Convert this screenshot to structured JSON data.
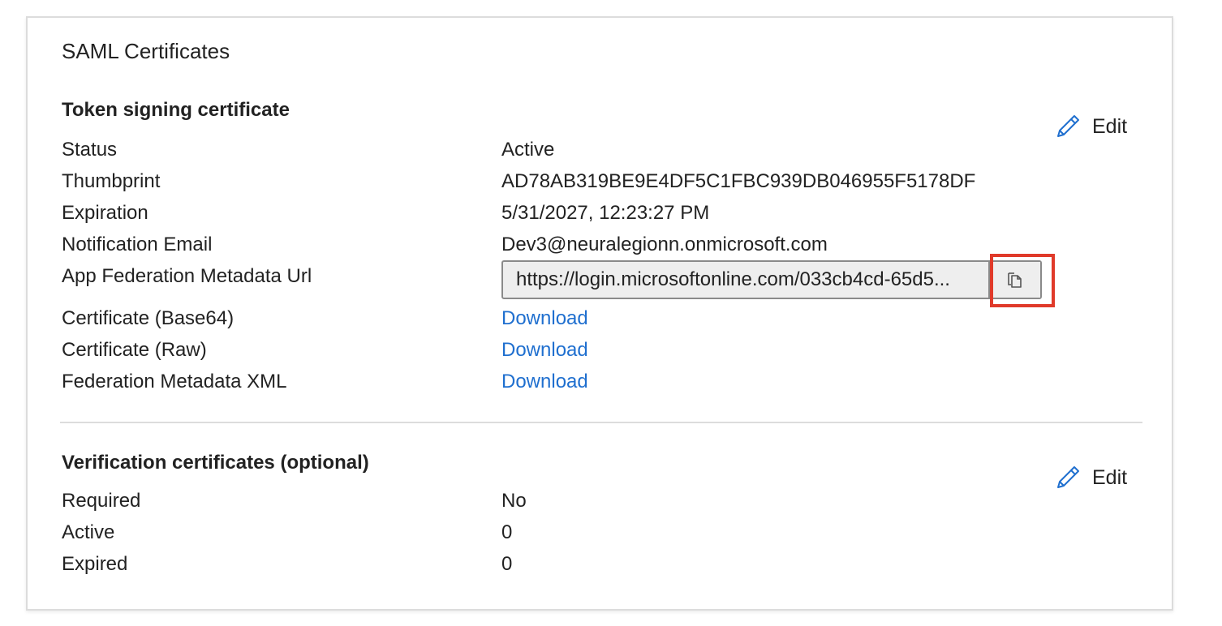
{
  "card": {
    "title": "SAML Certificates"
  },
  "token_signing": {
    "title": "Token signing certificate",
    "edit_label": "Edit",
    "rows": [
      {
        "label": "Status",
        "value": "Active"
      },
      {
        "label": "Thumbprint",
        "value": "AD78AB319BE9E4DF5C1FBC939DB046955F5178DF"
      },
      {
        "label": "Expiration",
        "value": "5/31/2027, 12:23:27 PM"
      },
      {
        "label": "Notification Email",
        "value": "Dev3@neuralegionn.onmicrosoft.com"
      },
      {
        "label": "App Federation Metadata Url",
        "value": "https://login.microsoftonline.com/033cb4cd-65d5..."
      },
      {
        "label": "Certificate (Base64)",
        "value": "Download"
      },
      {
        "label": "Certificate (Raw)",
        "value": "Download"
      },
      {
        "label": "Federation Metadata XML",
        "value": "Download"
      }
    ]
  },
  "verification": {
    "title": "Verification certificates (optional)",
    "edit_label": "Edit",
    "rows": [
      {
        "label": "Required",
        "value": "No"
      },
      {
        "label": "Active",
        "value": "0"
      },
      {
        "label": "Expired",
        "value": "0"
      }
    ]
  },
  "icons": {
    "edit": "pencil-icon",
    "copy": "copy-icon"
  },
  "colors": {
    "link": "#1f6fcf",
    "highlight": "#e03a2a",
    "border": "#dcdcdc"
  }
}
